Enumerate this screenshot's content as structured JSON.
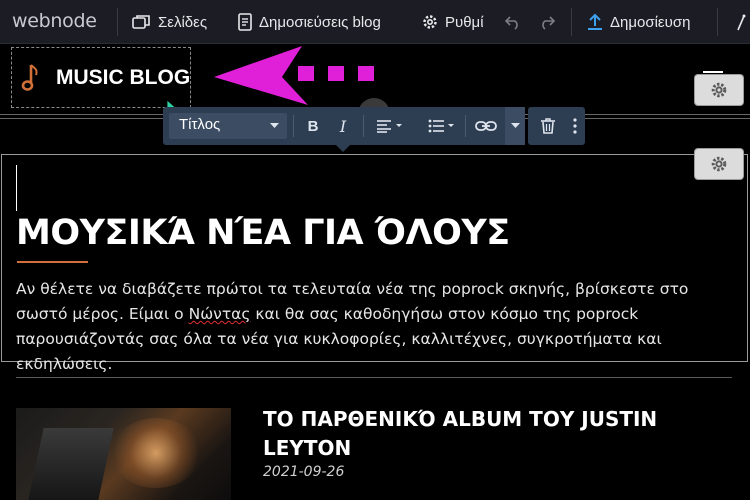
{
  "topbar": {
    "brand": "webnode",
    "pages": "Σελίδες",
    "blog_posts": "Δημοσιεύσεις blog",
    "settings": "Ρυθμί",
    "publish": "Δημοσίευση"
  },
  "site": {
    "title": "MUSIC BLOG"
  },
  "format_toolbar": {
    "style_select": "Τίτλος",
    "bold": "B",
    "italic": "I"
  },
  "content": {
    "heading": "ΜΟΥΣΙΚΆ ΝΈΑ ΓΙΑ ΌΛΟΥΣ",
    "para_before": "Αν θέλετε να διαβάζετε πρώτοι τα τελευταία νέα της poprock σκηνής, βρίσκεστε στο σωστό μέρος. Είμαι ο ",
    "para_name": "Νώντας",
    "para_after": " και θα σας καθοδηγήσω στον κόσμο της poprock παρουσιάζοντάς σας όλα τα νέα για κυκλοφορίες, καλλιτέχνες, συγκροτήματα και εκδηλώσεις."
  },
  "post": {
    "title": "ΤΟ ΠΑΡΘΕΝΙΚΌ ALBUM ΤΟΥ JUSTIN LEYTON",
    "date": "2021-09-26"
  },
  "colors": {
    "accent": "#d2703a",
    "toolbar_bg": "#2e3e52",
    "publish_icon": "#3ea0f0",
    "annotation": "#e020d8"
  }
}
